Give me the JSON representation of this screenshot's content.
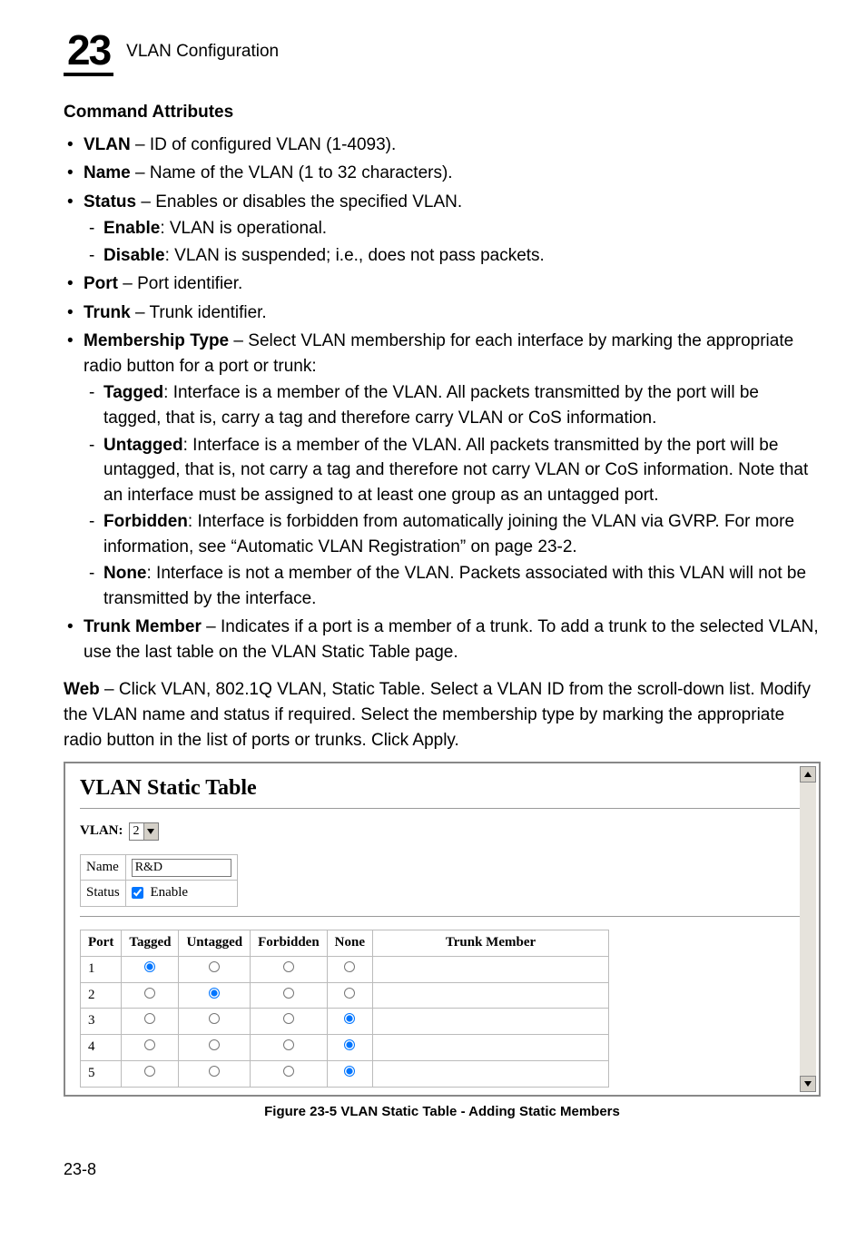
{
  "chapter": {
    "number": "23",
    "title": "VLAN Configuration"
  },
  "section": {
    "heading": "Command Attributes"
  },
  "attrs": {
    "vlan": {
      "term": "VLAN",
      "desc": " – ID of configured VLAN (1-4093)."
    },
    "name": {
      "term": "Name",
      "desc": " – Name of the VLAN (1 to 32 characters)."
    },
    "status": {
      "term": "Status",
      "desc": " – Enables or disables the specified VLAN.",
      "enable": {
        "term": "Enable",
        "desc": ": VLAN is operational."
      },
      "disable": {
        "term": "Disable",
        "desc": ": VLAN is suspended; i.e., does not pass packets."
      }
    },
    "port": {
      "term": "Port",
      "desc": " – Port identifier."
    },
    "trunk": {
      "term": "Trunk",
      "desc": " – Trunk identifier."
    },
    "membership": {
      "term": "Membership Type",
      "desc": " – Select VLAN membership for each interface by marking the appropriate radio button for a port or trunk:",
      "tagged": {
        "term": "Tagged",
        "desc": ": Interface is a member of the VLAN. All packets transmitted by the port will be tagged, that is, carry a tag and therefore carry VLAN or CoS information."
      },
      "untagged": {
        "term": "Untagged",
        "desc": ": Interface is a member of the VLAN. All packets transmitted by the port will be untagged, that is, not carry a tag and therefore not carry VLAN or CoS information. Note that an interface must be assigned to at least one group as an untagged port."
      },
      "forbidden": {
        "term": "Forbidden",
        "desc": ": Interface is forbidden from automatically joining the VLAN via GVRP. For more information, see “Automatic VLAN Registration” on page 23-2."
      },
      "none": {
        "term": "None",
        "desc": ": Interface is not a member of the VLAN. Packets associated with this VLAN will not be transmitted by the interface."
      }
    },
    "trunkmember": {
      "term": "Trunk Member",
      "desc": " – Indicates if a port is a member of a trunk. To add a trunk to the selected VLAN, use the last table on the VLAN Static Table page."
    }
  },
  "web": {
    "term": "Web",
    "desc": " – Click VLAN, 802.1Q VLAN, Static Table. Select a VLAN ID from the scroll-down list. Modify the VLAN name and status if required. Select the membership type by marking the appropriate radio button in the list of ports or trunks. Click Apply."
  },
  "figure": {
    "title": "VLAN Static Table",
    "vlan_label": "VLAN:",
    "vlan_value": "2",
    "form": {
      "name_label": "Name",
      "name_value": "R&D",
      "status_label": "Status",
      "status_text": "Enable"
    },
    "columns": {
      "port": "Port",
      "tagged": "Tagged",
      "untagged": "Untagged",
      "forbidden": "Forbidden",
      "none": "None",
      "trunkmember": "Trunk Member"
    },
    "rows": [
      {
        "port": "1",
        "sel": "tagged"
      },
      {
        "port": "2",
        "sel": "untagged"
      },
      {
        "port": "3",
        "sel": "none"
      },
      {
        "port": "4",
        "sel": "none"
      },
      {
        "port": "5",
        "sel": "none"
      }
    ],
    "caption": "Figure 23-5  VLAN Static Table - Adding Static Members"
  },
  "page": "23-8"
}
